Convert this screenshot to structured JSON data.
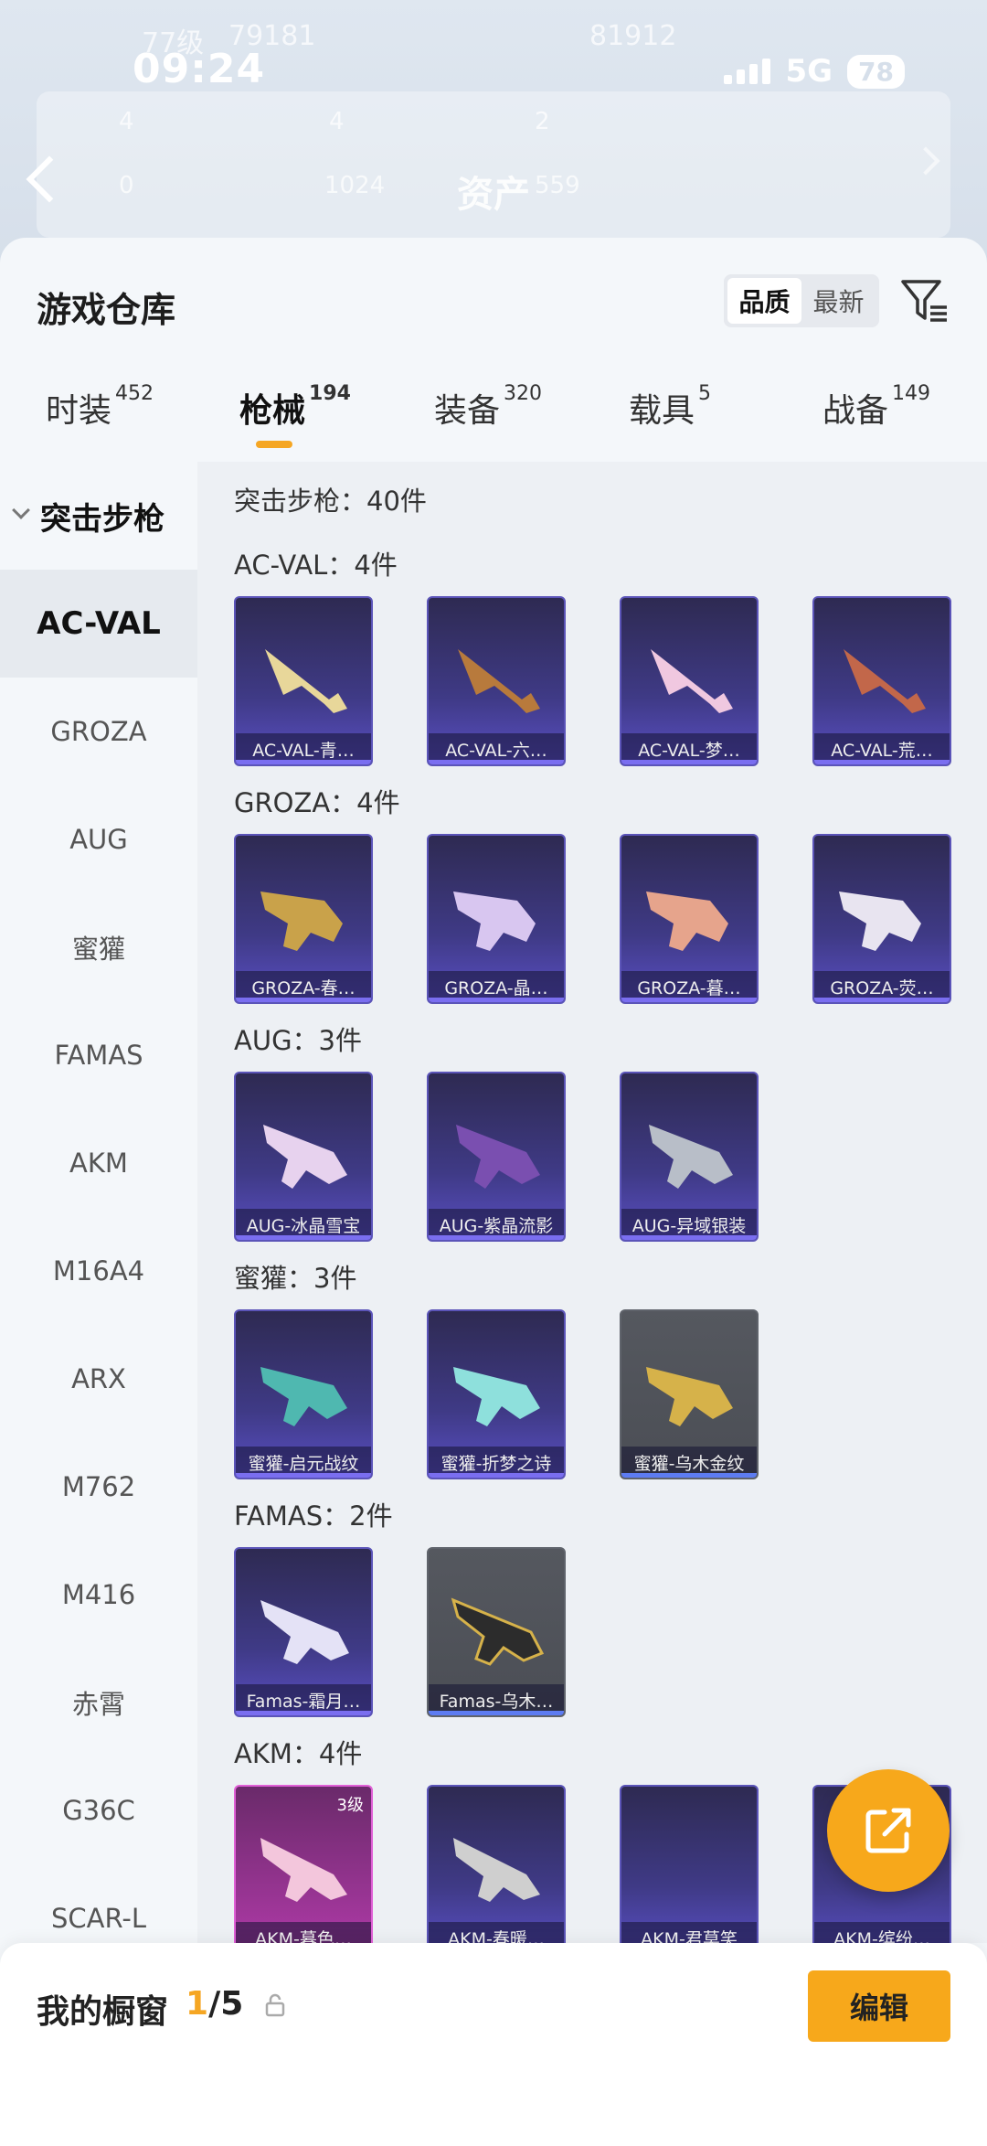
{
  "status_bar": {
    "time": "09:24",
    "network": "5G",
    "battery": "78"
  },
  "background_header": {
    "level": "77级",
    "views": "79181",
    "fans": "81912",
    "stat_a": "4",
    "stat_b": "4",
    "stat_c": "2",
    "stat_d": "0",
    "stat_e": "1024",
    "stat_f": "559",
    "asset_title": "资产"
  },
  "sheet": {
    "title": "游戏仓库"
  },
  "sort": {
    "quality": "品质",
    "latest": "最新"
  },
  "tabs": [
    {
      "label": "时装",
      "count": "452"
    },
    {
      "label": "枪械",
      "count": "194"
    },
    {
      "label": "装备",
      "count": "320"
    },
    {
      "label": "载具",
      "count": "5"
    },
    {
      "label": "战备",
      "count": "149"
    }
  ],
  "sidebar": {
    "group": "突击步枪",
    "items": [
      "AC-VAL",
      "GROZA",
      "AUG",
      "蜜獾",
      "FAMAS",
      "AKM",
      "M16A4",
      "ARX",
      "M762",
      "M416",
      "赤霄",
      "G36C",
      "SCAR-L"
    ]
  },
  "content": {
    "total": "突击步枪：40件",
    "categories": [
      {
        "head": "AC-VAL：4件",
        "items": [
          "AC-VAL-青…",
          "AC-VAL-六…",
          "AC-VAL-梦…",
          "AC-VAL-荒…"
        ]
      },
      {
        "head": "GROZA：4件",
        "items": [
          "GROZA-春…",
          "GROZA-晶…",
          "GROZA-暮…",
          "GROZA-荧…"
        ]
      },
      {
        "head": "AUG：3件",
        "items": [
          "AUG-冰晶雪宝",
          "AUG-紫晶流影",
          "AUG-异域银装"
        ]
      },
      {
        "head": "蜜獾：3件",
        "items": [
          "蜜獾-启元战纹",
          "蜜獾-折梦之诗",
          "蜜獾-乌木金纹"
        ]
      },
      {
        "head": "FAMAS：2件",
        "items": [
          "Famas-霜月…",
          "Famas-乌木…"
        ]
      },
      {
        "head": "AKM：4件",
        "items": [
          "AKM-暮色…",
          "AKM-春暖…",
          "AKM-君莫笑",
          "AKM-缤纷…"
        ],
        "level_badge": "3级"
      }
    ]
  },
  "showcase": {
    "label": "我的橱窗",
    "current": "1",
    "total": "/5",
    "edit": "编辑"
  },
  "colors": {
    "accent": "#f7a81b",
    "card_purple": "#3f3a86",
    "card_gray": "#4b4e55"
  }
}
